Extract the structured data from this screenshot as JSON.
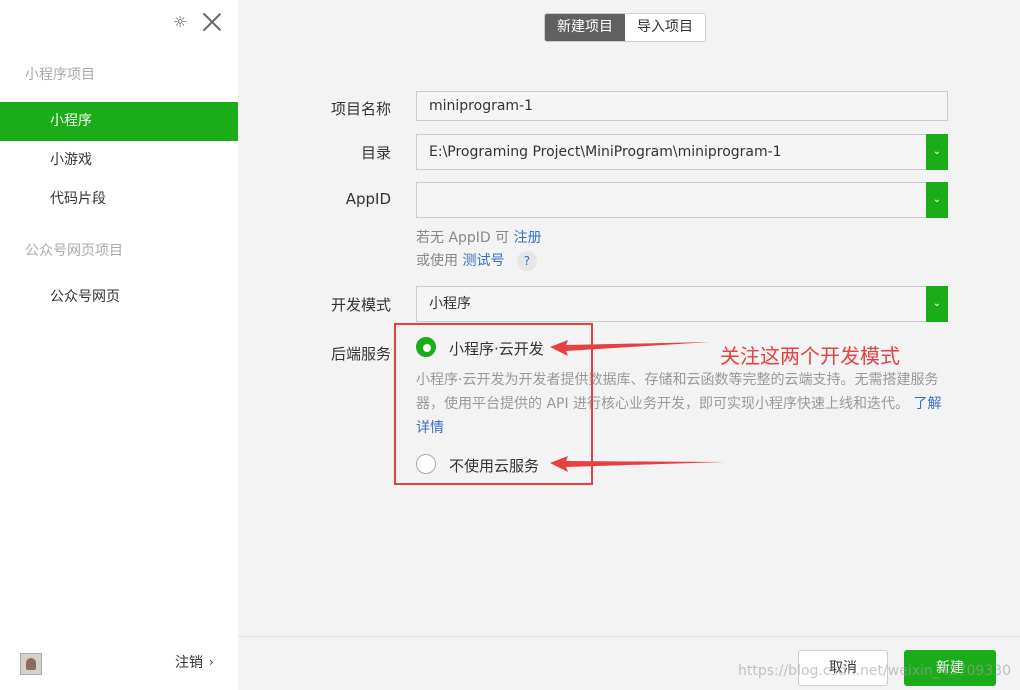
{
  "sidebar": {
    "section_miniprogram": "小程序项目",
    "items_mp": [
      {
        "label": "小程序",
        "active": true
      },
      {
        "label": "小游戏",
        "active": false
      },
      {
        "label": "代码片段",
        "active": false
      }
    ],
    "section_official": "公众号网页项目",
    "items_official": [
      {
        "label": "公众号网页",
        "active": false
      }
    ],
    "logout_label": "注销"
  },
  "tabs": [
    {
      "label": "新建项目",
      "active": true
    },
    {
      "label": "导入项目",
      "active": false
    }
  ],
  "form": {
    "project_name_label": "项目名称",
    "project_name_value": "miniprogram-1",
    "dir_label": "目录",
    "dir_value": "E:\\Programing Project\\MiniProgram\\miniprogram-1",
    "appid_label": "AppID",
    "appid_value": "",
    "hint1_prefix": "若无 AppID 可",
    "hint1_link": "注册",
    "hint2_prefix": "或使用",
    "hint2_link": "测试号",
    "help_mark": "?",
    "devmode_label": "开发模式",
    "devmode_value": "小程序",
    "backend_label": "后端服务",
    "option_cloud": "小程序·云开发",
    "option_cloud_checked": true,
    "cloud_desc": "小程序·云开发为开发者提供数据库、存储和云函数等完整的云端支持。无需搭建服务器，使用平台提供的 API 进行核心业务开发，即可实现小程序快速上线和迭代。",
    "cloud_more_link": "了解详情",
    "option_none": "不使用云服务",
    "option_none_checked": false
  },
  "annotation": {
    "text": "关注这两个开发模式",
    "color": "#e84040"
  },
  "footer": {
    "cancel_label": "取消",
    "create_label": "新建",
    "watermark": "https://blog.csdn.net/weixin_43709330"
  },
  "colors": {
    "accent": "#1aad19",
    "link": "#3a6ec8"
  },
  "icons": {
    "gear": "gear-icon",
    "close": "close-icon",
    "dropdown": "chevron-down-icon",
    "logout_chevron": "chevron-right-icon",
    "avatar": "avatar"
  }
}
